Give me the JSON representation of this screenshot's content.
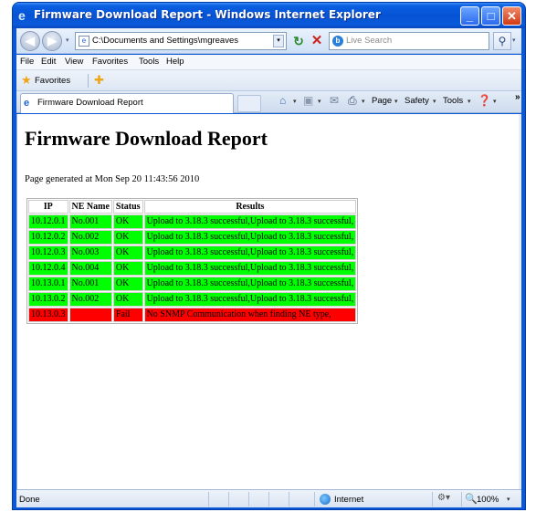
{
  "window": {
    "title": "Firmware Download Report - Windows Internet Explorer"
  },
  "address_bar": {
    "url": "C:\\Documents and Settings\\mgreaves",
    "search_placeholder": "Live Search"
  },
  "menu": {
    "items": [
      "File",
      "Edit",
      "View",
      "Favorites",
      "Tools",
      "Help"
    ]
  },
  "favorites_bar": {
    "label": "Favorites"
  },
  "tab": {
    "label": "Firmware Download Report"
  },
  "command_bar": {
    "page": "Page",
    "safety": "Safety",
    "tools": "Tools"
  },
  "report": {
    "title": "Firmware Download Report",
    "generated": "Page generated at Mon Sep 20 11:43:56 2010",
    "columns": [
      "IP",
      "NE Name",
      "Status",
      "Results"
    ],
    "rows": [
      {
        "ip": "10.12.0.1",
        "ne_name": "No.001",
        "status": "OK",
        "results": "Upload to 3.18.3 successful,Upload to 3.18.3 successful,",
        "state": "ok"
      },
      {
        "ip": "10.12.0.2",
        "ne_name": "No.002",
        "status": "OK",
        "results": "Upload to 3.18.3 successful,Upload to 3.18.3 successful,",
        "state": "ok"
      },
      {
        "ip": "10.12.0.3",
        "ne_name": "No.003",
        "status": "OK",
        "results": "Upload to 3.18.3 successful,Upload to 3.18.3 successful,",
        "state": "ok"
      },
      {
        "ip": "10.12.0.4",
        "ne_name": "No.004",
        "status": "OK",
        "results": "Upload to 3.18.3 successful,Upload to 3.18.3 successful,",
        "state": "ok"
      },
      {
        "ip": "10.13.0.1",
        "ne_name": "No.001",
        "status": "OK",
        "results": "Upload to 3.18.3 successful,Upload to 3.18.3 successful,",
        "state": "ok"
      },
      {
        "ip": "10.13.0.2",
        "ne_name": "No.002",
        "status": "OK",
        "results": "Upload to 3.18.3 successful,Upload to 3.18.3 successful,",
        "state": "ok"
      },
      {
        "ip": "10.13.0.3",
        "ne_name": "",
        "status": "Fail",
        "results": "No SNMP Communication when finding NE type,",
        "state": "fail"
      }
    ]
  },
  "status_bar": {
    "status": "Done",
    "zone": "Internet",
    "zoom": "100%"
  },
  "colors": {
    "ok_row": "#00ff00",
    "fail_row": "#ff0000",
    "title_bar": "#0653d6"
  }
}
